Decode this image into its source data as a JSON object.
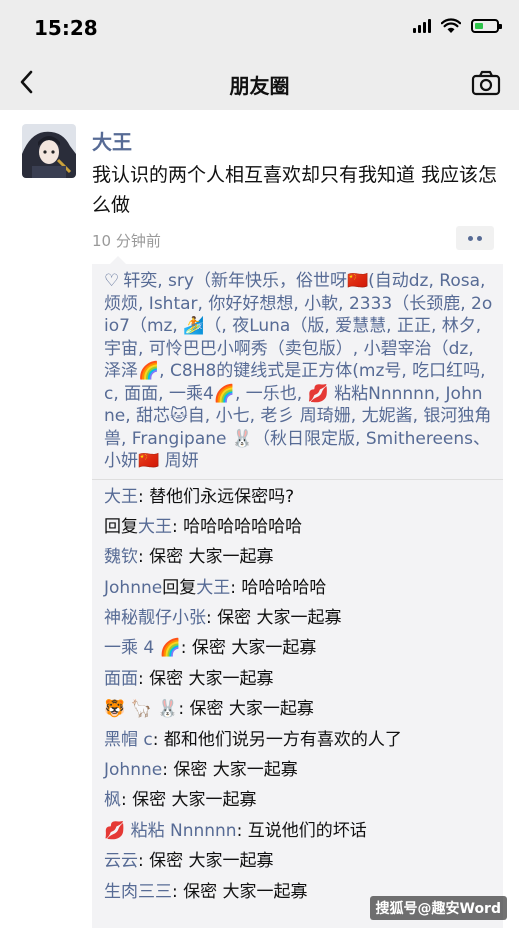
{
  "status_bar": {
    "time": "15:28"
  },
  "nav": {
    "title": "朋友圈"
  },
  "post": {
    "author": "大王",
    "text": "我认识的两个人相互喜欢却只有我知道 我应该怎么做",
    "timestamp": "10 分钟前"
  },
  "likes": {
    "heart_icon": "♡",
    "text": "轩奕, sry（新年快乐，俗世呀🇨🇳(自动dz, Rosa, 烦烦, Ishtar, 你好好想想, 小軟, 2333（长颈鹿, 2oio7（mz, 🏄（, 夜Luna（版, 爱慧慧, 正正, 林夕, 宇宙, 可怜巴巴小啊秀（卖包版）, 小碧宰治（dz, 泽泽🌈, C8H8的键线式是正方体(mz号, 吃口红吗, c, 面面, 一乘4🌈, 一乐也, 💋 粘粘Nnnnnn, Johnne, 甜芯🐱自, 小七, 老彡 周琦姗, 尢妮酱, 银河独角兽, Frangipane 🐰（秋日限定版, Smithereens、小妍🇨🇳 周妍"
  },
  "comments": [
    {
      "name": "大王",
      "text": ": 替他们永远保密吗?"
    },
    {
      "prefix": "回复",
      "name": "大王",
      "text": ": 哈哈哈哈哈哈哈"
    },
    {
      "name": "魏钦",
      "text": ": 保密 大家一起寡"
    },
    {
      "name": "Johnne",
      "prefix2": "回复",
      "name2": "大王",
      "text": ": 哈哈哈哈哈"
    },
    {
      "name": "神秘靓仔小张",
      "text": ": 保密 大家一起寡"
    },
    {
      "name": "一乘 4 🌈",
      "text": ": 保密 大家一起寡"
    },
    {
      "name": "面面",
      "text": ": 保密 大家一起寡"
    },
    {
      "name": "🐯 🦙 🐰",
      "text": ": 保密 大家一起寡"
    },
    {
      "name": "黑帽 c",
      "text": ": 都和他们说另一方有喜欢的人了"
    },
    {
      "name": "Johnne",
      "text": ": 保密 大家一起寡"
    },
    {
      "name": "枫",
      "text": ": 保密 大家一起寡"
    },
    {
      "name": "💋 粘粘 Nnnnnn",
      "text": ": 互说他们的坏话"
    },
    {
      "name": "云云",
      "text": ": 保密 大家一起寡"
    },
    {
      "name": "生肉三三",
      "text": ": 保密 大家一起寡"
    }
  ],
  "watermark": "搜狐号@趣安Word",
  "colors": {
    "link": "#576b95",
    "nav_bg": "#ededed",
    "comment_bg": "#f3f3f5",
    "battery": "#2ec34a"
  }
}
